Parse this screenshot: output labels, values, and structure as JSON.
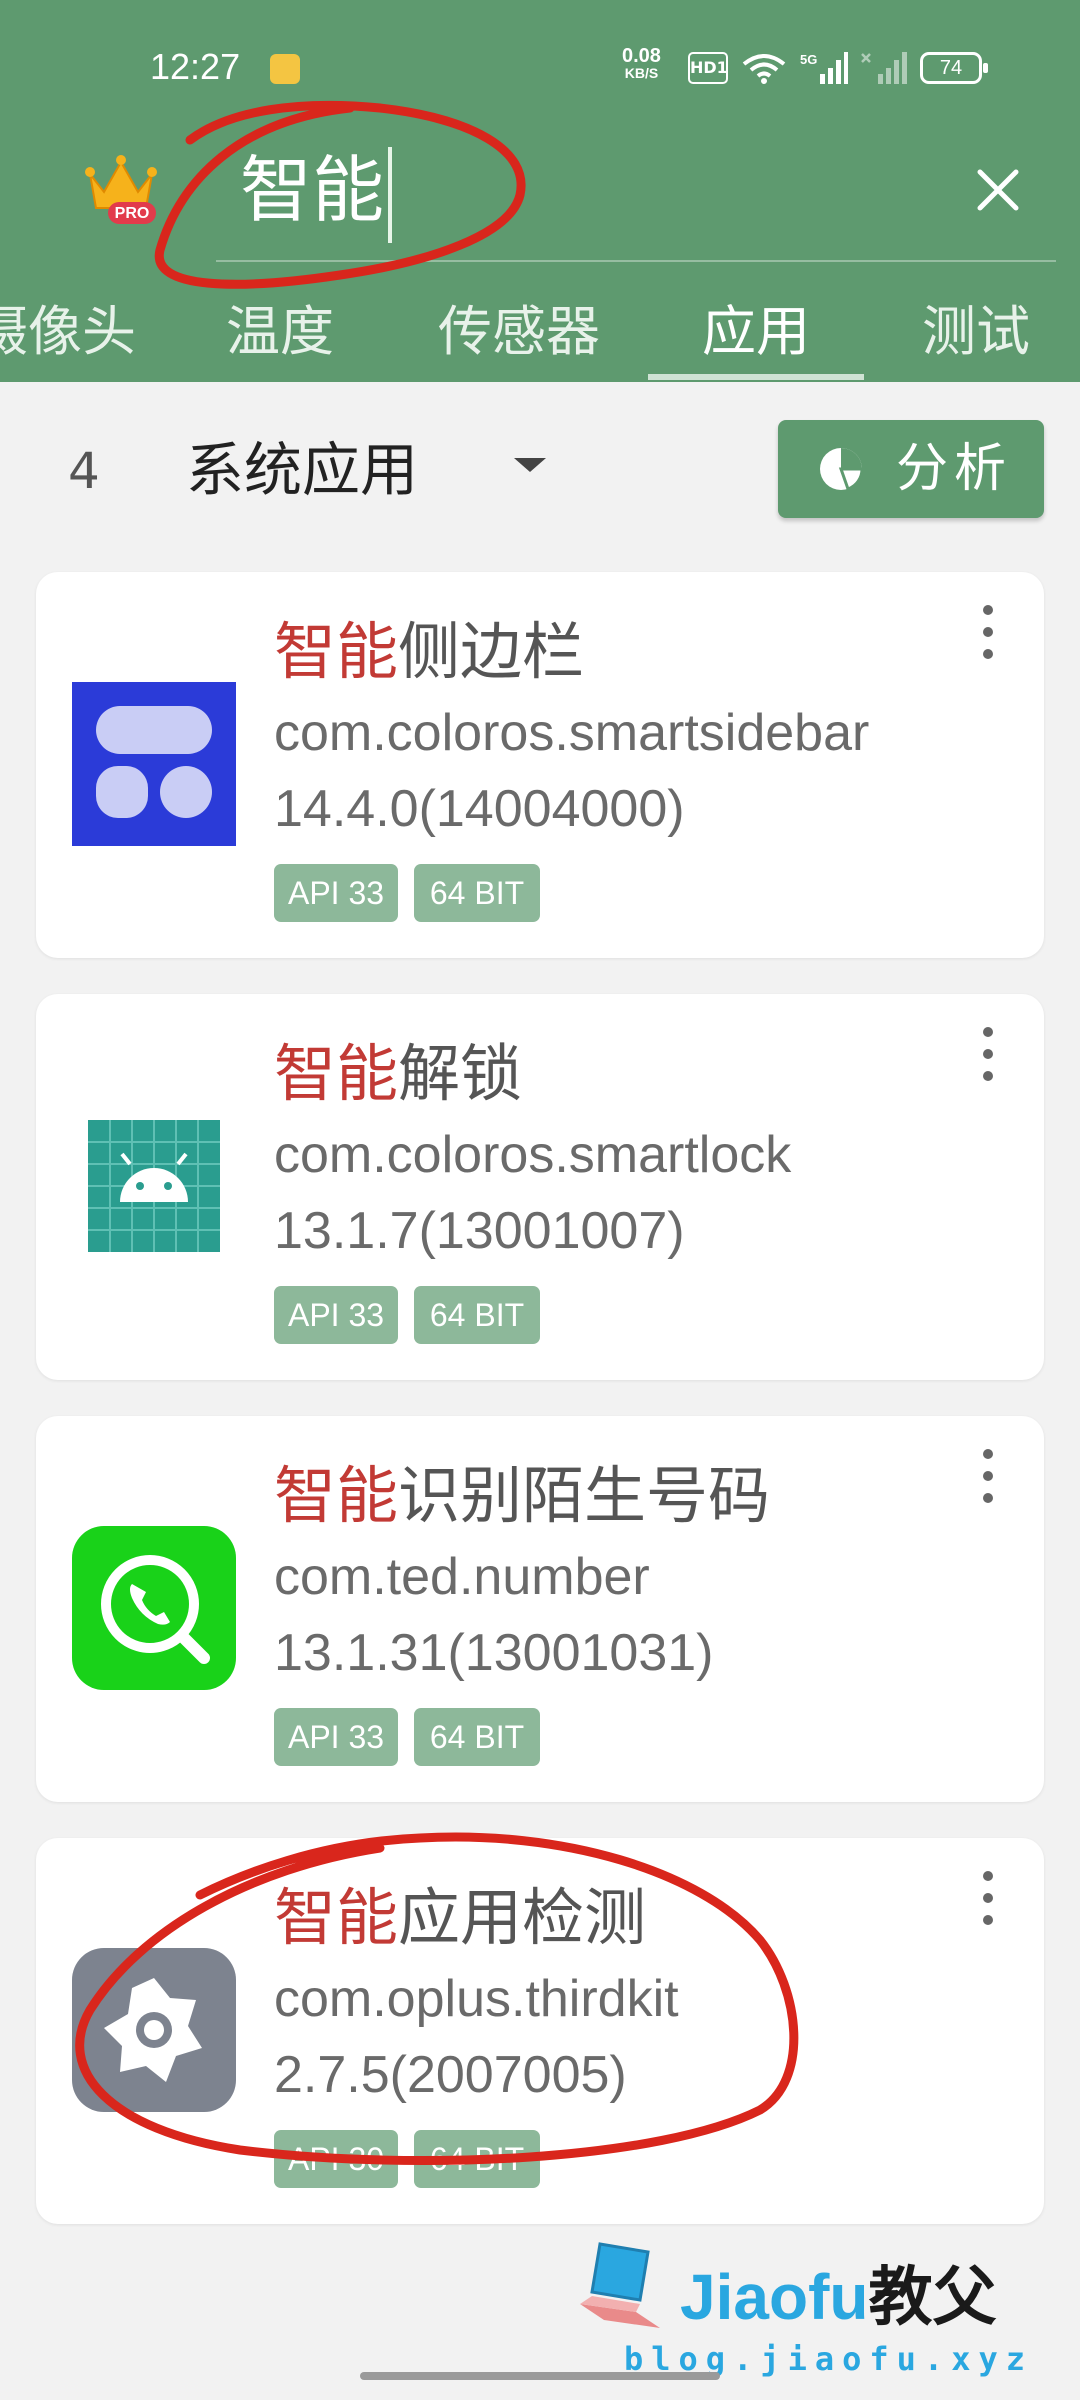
{
  "status_bar": {
    "time": "12:27",
    "net_speed_value": "0.08",
    "net_speed_unit": "KB/S",
    "hd": "HD1",
    "network": "5G",
    "battery": "74"
  },
  "search": {
    "query": "智能"
  },
  "tabs": [
    "摄像头",
    "温度",
    "传感器",
    "应用",
    "测试"
  ],
  "active_tab": "应用",
  "filter": {
    "count": "4",
    "category": "系统应用",
    "analyze_label": "分析"
  },
  "apps": [
    {
      "highlight": "智能",
      "title_rest": "侧边栏",
      "package": "com.coloros.smartsidebar",
      "version": "14.4.0(14004000)",
      "api": "API 33",
      "bits": "64 BIT",
      "icon": "sidebar-app-icon"
    },
    {
      "highlight": "智能",
      "title_rest": "解锁",
      "package": "com.coloros.smartlock",
      "version": "13.1.7(13001007)",
      "api": "API 33",
      "bits": "64 BIT",
      "icon": "android-app-icon"
    },
    {
      "highlight": "智能",
      "title_rest": "识别陌生号码",
      "package": "com.ted.number",
      "version": "13.1.31(13001031)",
      "api": "API 33",
      "bits": "64 BIT",
      "icon": "phone-search-icon"
    },
    {
      "highlight": "智能",
      "title_rest": "应用检测",
      "package": "com.oplus.thirdkit",
      "version": "2.7.5(2007005)",
      "api": "API 30",
      "bits": "64 BIT",
      "icon": "gear-app-icon"
    }
  ],
  "watermark": {
    "brand_latin": "Jiaofu",
    "brand_cn": "教父",
    "url": "blog.jiaofu.xyz"
  },
  "colors": {
    "primary": "#5e9a6f",
    "highlight": "#c23a35",
    "badge": "#8db89a",
    "annotation": "#d9261c"
  }
}
